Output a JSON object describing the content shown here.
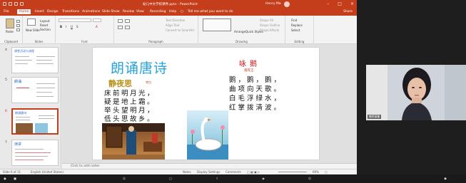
{
  "window": {
    "title": "幼儿中文学校课件.pptx - PowerPoint",
    "user": "Henry Ma"
  },
  "tabs": [
    "File",
    "Home",
    "Insert",
    "Design",
    "Transitions",
    "Animations",
    "Slide Show",
    "Review",
    "View",
    "Recording",
    "Help"
  ],
  "active_tab": "Home",
  "tell_me": "Tell me what you want to do",
  "share": "Share",
  "ribbon": {
    "groups": [
      "Clipboard",
      "Slides",
      "Font",
      "Paragraph",
      "Drawing",
      "Editing"
    ],
    "paste": "Paste",
    "new_slide": "New Slide",
    "layout": "Layout",
    "reset": "Reset",
    "section": "Section",
    "text_direction": "Text Direction",
    "align_text": "Align Text",
    "convert_smartart": "Convert to SmartArt",
    "arrange": "Arrange",
    "quick_styles": "Quick Styles",
    "shape_fill": "Shape Fill",
    "shape_outline": "Shape Outline",
    "shape_effects": "Shape Effects",
    "find": "Find",
    "replace": "Replace",
    "select": "Select"
  },
  "thumbnails": [
    {
      "num": "4",
      "title": "课堂活动与流程"
    },
    {
      "num": "5",
      "title": "朗诵"
    },
    {
      "num": "6",
      "title": "朗诵唐诗"
    },
    {
      "num": "7",
      "title": "演讲"
    }
  ],
  "slide": {
    "left_title": "朗诵唐诗",
    "poem1": {
      "title": "静夜思",
      "author": "李白",
      "lines": [
        "床前明月光，",
        "疑是地上霜。",
        "举头望明月，",
        "低头思故乡。"
      ]
    },
    "poem2": {
      "title": "咏鹅",
      "author": "骆宾王",
      "lines": [
        "鹅，鹅，鹅，",
        "曲项向天歌。",
        "白毛浮绿水，",
        "红掌拨清波。"
      ]
    }
  },
  "notes_placeholder": "Click to add notes",
  "status": {
    "slide_info": "Slide 6 of 11",
    "language": "English (United States)",
    "notes": "Notes",
    "display_settings": "Display Settings",
    "comments": "Comments",
    "zoom": "69%"
  },
  "video": {
    "name": "教师录像"
  },
  "colors": {
    "accent": "#c43e1c",
    "slide_title": "#29a3dc",
    "poem_red": "#cc1111"
  }
}
